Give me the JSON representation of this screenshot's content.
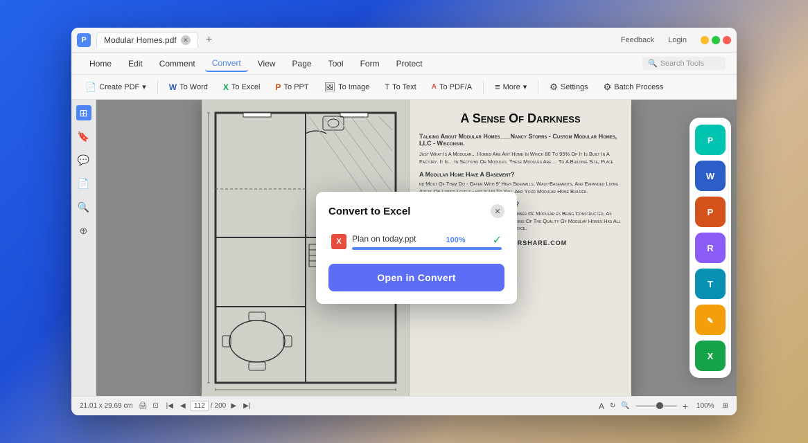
{
  "window": {
    "title": "Modular Homes.pdf",
    "feedback_label": "Feedback",
    "login_label": "Login"
  },
  "menu": {
    "items": [
      {
        "id": "home",
        "label": "Home"
      },
      {
        "id": "edit",
        "label": "Edit"
      },
      {
        "id": "comment",
        "label": "Comment"
      },
      {
        "id": "convert",
        "label": "Convert",
        "active": true
      },
      {
        "id": "view",
        "label": "View"
      },
      {
        "id": "page",
        "label": "Page"
      },
      {
        "id": "tool",
        "label": "Tool"
      },
      {
        "id": "form",
        "label": "Form"
      },
      {
        "id": "protect",
        "label": "Protect"
      }
    ],
    "search_placeholder": "Search Tools"
  },
  "toolbar": {
    "buttons": [
      {
        "id": "create-pdf",
        "label": "Create PDF",
        "icon": "📄",
        "dropdown": true
      },
      {
        "id": "to-word",
        "label": "To Word",
        "icon": "W"
      },
      {
        "id": "to-excel",
        "label": "To Excel",
        "icon": "X"
      },
      {
        "id": "to-ppt",
        "label": "To PPT",
        "icon": "P"
      },
      {
        "id": "to-image",
        "label": "To Image",
        "icon": "🖼"
      },
      {
        "id": "to-text",
        "label": "To Text",
        "icon": "T"
      },
      {
        "id": "to-pdf-a",
        "label": "To PDF/A",
        "icon": "A"
      },
      {
        "id": "more",
        "label": "More",
        "icon": "≡",
        "dropdown": true
      },
      {
        "id": "settings",
        "label": "Settings",
        "icon": "⚙"
      },
      {
        "id": "batch-process",
        "label": "Batch Process",
        "icon": "⚙"
      }
    ]
  },
  "document": {
    "title": "A Sense Of Darkness",
    "subtitle": "Talking About Modular Homes___Nancy Storrs - Custom Modular Homes, LLC - Wisconsin.",
    "paragraph1": "Just What Is A Modular... Homes Are Any Home In Which 80 To 95% Of It Is Built In A Factory. It Is... In Sections Or Modules. These Modules Are ... To A Building Site, Place",
    "section2_title": "A Modular Home Have A Basement?",
    "section2_text": "nd Most Of Them Do - Often With 9' High Sidewalls, Walk-Basements, And Expanded Living Areas On Lower Levels - hat Is Up To You, And Your Modular Home Builder.",
    "section3_title": "Modular Homes Difficult To Finance?",
    "section3_text": "hat Used To Be The Case, But The Sheer Number Of Modular es Being Constructed, As Well As The Lending Community's Understanding Of The Quality Of Modular Homes Has All But Eliminated Any Previously Existing Prejudice.",
    "watermark": "PDF.WONDERSHARE.COM"
  },
  "dialog": {
    "title": "Convert to Excel",
    "file_name": "Plan on today.ppt",
    "progress": 100,
    "progress_label": "100%",
    "open_btn_label": "Open in Convert",
    "close_icon": "✕"
  },
  "app_switcher": {
    "apps": [
      {
        "id": "pdf",
        "label": "P",
        "color": "pdf"
      },
      {
        "id": "word",
        "label": "W",
        "color": "word"
      },
      {
        "id": "ppt",
        "label": "P",
        "color": "ppt"
      },
      {
        "id": "wps",
        "label": "R",
        "color": "wps"
      },
      {
        "id": "text",
        "label": "T",
        "color": "text"
      },
      {
        "id": "edit",
        "label": "✎",
        "color": "edit"
      },
      {
        "id": "excel",
        "label": "X",
        "color": "excel"
      }
    ]
  },
  "status_bar": {
    "dimensions": "21.01 x 29.69 cm",
    "page_current": "112",
    "page_total": "200",
    "zoom": "100%"
  }
}
